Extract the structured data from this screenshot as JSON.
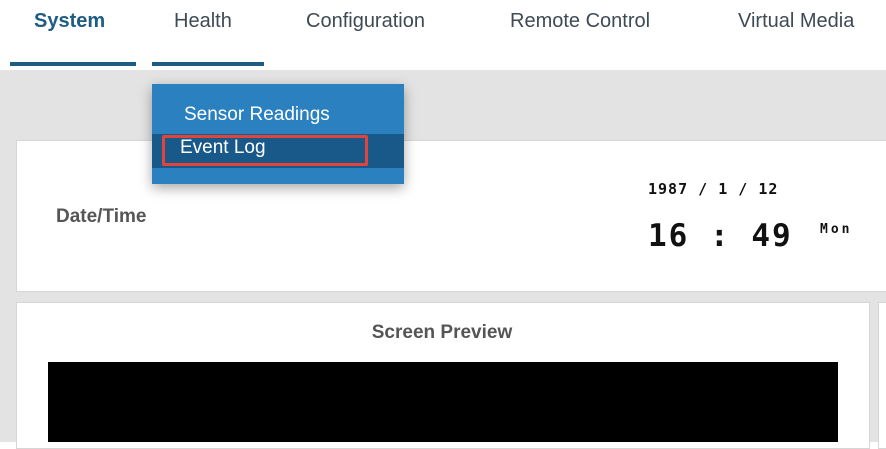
{
  "nav": {
    "tabs": [
      {
        "label": "System",
        "active": true
      },
      {
        "label": "Health",
        "active": false
      },
      {
        "label": "Configuration",
        "active": false
      },
      {
        "label": "Remote Control",
        "active": false
      },
      {
        "label": "Virtual Media",
        "active": false
      }
    ],
    "accent_color": "#1e5c84"
  },
  "health_menu": {
    "items": [
      {
        "label": "Sensor Readings",
        "selected": false
      },
      {
        "label": "Event Log",
        "selected": true
      }
    ],
    "background_color": "#2b80c0",
    "highlight_color": "#e0443c"
  },
  "datetime": {
    "label": "Date/Time",
    "date": "1987 / 1 / 12",
    "time": "16 : 49",
    "day": "Mon"
  },
  "preview": {
    "title": "Screen Preview"
  }
}
